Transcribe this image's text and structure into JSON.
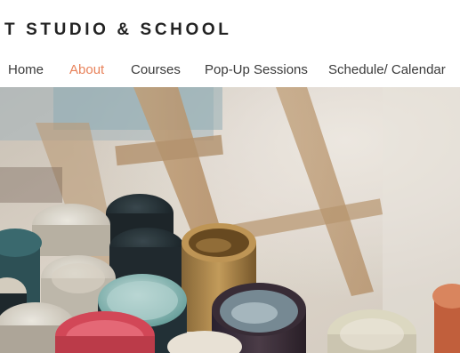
{
  "header": {
    "brand": "T STUDIO & SCHOOL"
  },
  "nav": {
    "items": [
      {
        "label": "Home"
      },
      {
        "label": "About"
      },
      {
        "label": "Courses"
      },
      {
        "label": "Pop-Up Sessions"
      },
      {
        "label": "Schedule/ Calendar"
      }
    ],
    "active_color": "#e8825a",
    "text_color": "#3b3b3b"
  },
  "hero": {
    "image": "paint-jars-photo"
  }
}
